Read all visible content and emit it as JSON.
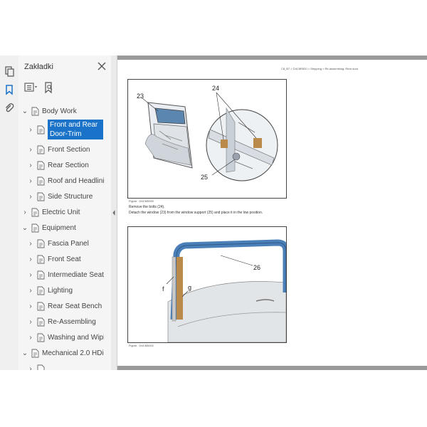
{
  "sidebar": {
    "title": "Zakładki",
    "tree": [
      {
        "label": "Body Work",
        "level": 0,
        "state": "expanded"
      },
      {
        "label": "Front and Rear Door-Trim",
        "level": 1,
        "state": "collapsed",
        "selected": true
      },
      {
        "label": "Front Section",
        "level": 1,
        "state": "collapsed"
      },
      {
        "label": "Rear Section",
        "level": 1,
        "state": "collapsed"
      },
      {
        "label": "Roof and Headlining",
        "level": 1,
        "state": "collapsed"
      },
      {
        "label": "Side Structure",
        "level": 1,
        "state": "collapsed"
      },
      {
        "label": "Electric Unit",
        "level": 0,
        "state": "collapsed"
      },
      {
        "label": "Equipment",
        "level": 0,
        "state": "expanded"
      },
      {
        "label": "Fascia Panel",
        "level": 1,
        "state": "collapsed"
      },
      {
        "label": "Front Seat",
        "level": 1,
        "state": "collapsed"
      },
      {
        "label": "Intermediate Seat",
        "level": 1,
        "state": "collapsed"
      },
      {
        "label": "Lighting",
        "level": 1,
        "state": "collapsed"
      },
      {
        "label": "Rear Seat Bench Seat",
        "level": 1,
        "state": "collapsed"
      },
      {
        "label": "Re-Assembling",
        "level": 1,
        "state": "collapsed"
      },
      {
        "label": "Washing and Wiping",
        "level": 1,
        "state": "collapsed"
      },
      {
        "label": "Mechanical 2.0 HDi",
        "level": 0,
        "state": "expanded"
      }
    ]
  },
  "document": {
    "running_header": "C8_B7 > D4C8R520 > Stripping > Re-assembling: Rear door",
    "figure1": {
      "callouts": [
        "23",
        "24",
        "25"
      ],
      "caption": "Figure : D4CM0000"
    },
    "instructions": [
      "Remove the bolts (24).",
      "Detach the window (23) from the window support (25) and place it in the low position."
    ],
    "figure2": {
      "callouts": [
        "26",
        "f",
        "g"
      ],
      "caption": "Figure : D4CM0002"
    }
  },
  "colors": {
    "selection": "#1a73c8",
    "seal_blue": "#4a7fb8",
    "glass": "#5b86b0",
    "felt": "#b98a4a"
  }
}
